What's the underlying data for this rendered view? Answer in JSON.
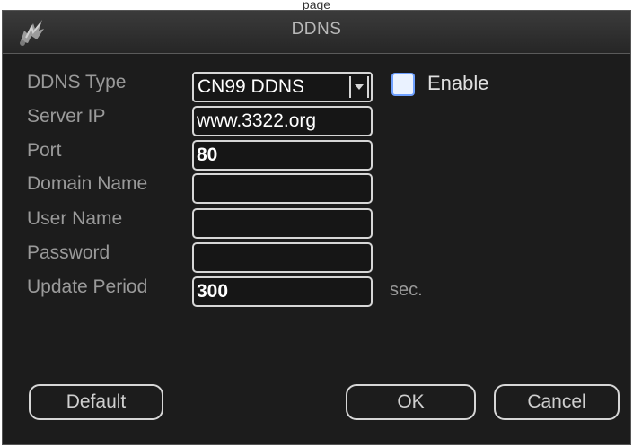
{
  "dialog": {
    "title": "DDNS",
    "top_strip": "page"
  },
  "fields": {
    "ddns_type_label": "DDNS Type",
    "ddns_type_value": "CN99 DDNS",
    "enable_label": "Enable",
    "enable_checked": false,
    "server_ip_label": "Server IP",
    "server_ip_value": "www.3322.org",
    "port_label": "Port",
    "port_value": "80",
    "domain_name_label": "Domain Name",
    "domain_name_value": "",
    "user_name_label": "User Name",
    "user_name_value": "",
    "password_label": "Password",
    "password_value": "",
    "update_period_label": "Update Period",
    "update_period_value": "300",
    "update_period_unit": "sec."
  },
  "buttons": {
    "default": "Default",
    "ok": "OK",
    "cancel": "Cancel"
  },
  "colors": {
    "background": "#1c1c1c",
    "field_border": "#d6d6d6",
    "label_text": "#9a9a9a",
    "checkbox_fill": "#eaf2ff"
  }
}
